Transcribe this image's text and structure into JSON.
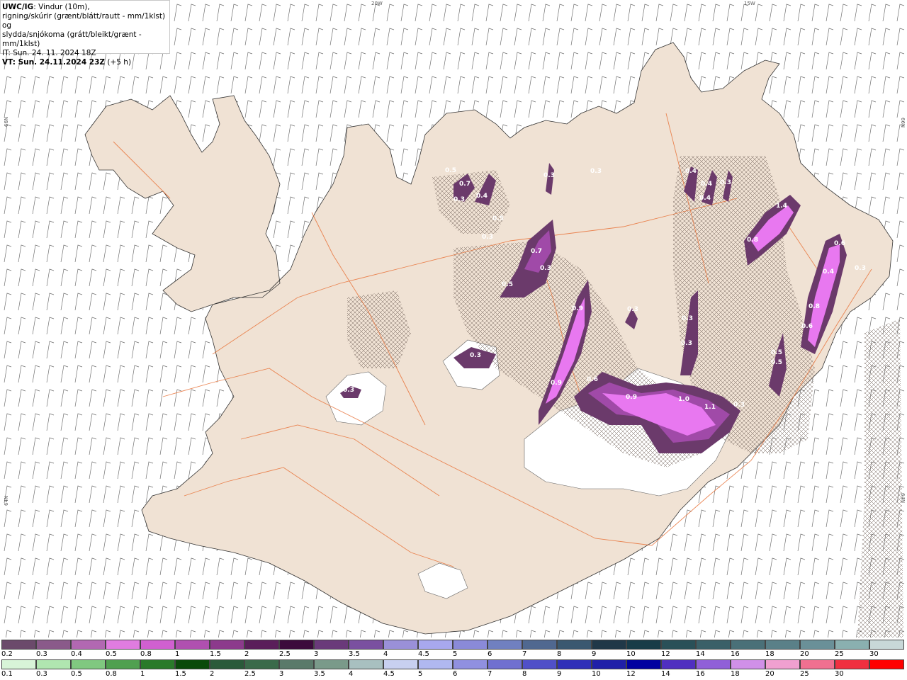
{
  "header": {
    "model": "UWC/IG",
    "line1_rest": ": Vindur (10m),",
    "line2": "rigning/skúrir (grænt/blátt/rautt - mm/1klst) og",
    "line3": "slydda/snjókoma (grátt/bleikt/grænt - mm/1klst)",
    "init_time": "IT: Sun. 24. 11. 2024 18Z",
    "valid_time": "VT: Sun. 24.11.2024 23Z",
    "lead": "(+5 h)"
  },
  "graticule": {
    "top_left": "20W",
    "top_right": "15W",
    "left_upper": "66N",
    "right_upper": "66N",
    "left_lower": "64N",
    "right_lower": "64N"
  },
  "precip_labels": [
    "0.3",
    "0.5",
    "0.7",
    "0.4",
    "0.3",
    "0.3",
    "0.5",
    "0.3",
    "0.7",
    "0.3",
    "0.5",
    "0.9",
    "0.9",
    "0.6",
    "0.9",
    "1.0",
    "1.1",
    "0.3",
    "0.3",
    "0.3",
    "0.3",
    "0.4",
    "0.4",
    "0.4",
    "0.3",
    "1.4",
    "0.8",
    "0.6",
    "0.4",
    "0.3",
    "0.8",
    "0.6",
    "0.5",
    "0.5",
    "0.3",
    "0.3"
  ],
  "legend_snow": {
    "labels": [
      "0.2",
      "0.3",
      "0.4",
      "0.5",
      "0.8",
      "1",
      "1.5",
      "2",
      "2.5",
      "3",
      "3.5",
      "4",
      "4.5",
      "5",
      "6",
      "7",
      "8",
      "9",
      "10",
      "12",
      "14",
      "16",
      "18",
      "20",
      "25",
      "30"
    ],
    "colors": [
      "#6b4a6b",
      "#8a5a8a",
      "#b268b2",
      "#e07ce0",
      "#d060d0",
      "#b050b0",
      "#8c3a8c",
      "#5a1e5a",
      "#3c0a3c",
      "#6a3a7a",
      "#7a50a0",
      "#9a90d8",
      "#a8a8ee",
      "#8a8ad8",
      "#7080c0",
      "#506890",
      "#3a5870",
      "#203848",
      "#183c48",
      "#2a5058",
      "#3a6068",
      "#4a7078",
      "#5a8088",
      "#6a9098",
      "#8ab0b0",
      "#c8d8d8"
    ]
  },
  "legend_rain": {
    "labels": [
      "0.1",
      "0.3",
      "0.5",
      "0.8",
      "1",
      "1.5",
      "2",
      "2.5",
      "3",
      "3.5",
      "4",
      "4.5",
      "5",
      "6",
      "7",
      "8",
      "9",
      "10",
      "12",
      "14",
      "16",
      "18",
      "20",
      "25",
      "30"
    ],
    "colors": [
      "#d8f4d8",
      "#b0e6b0",
      "#80c880",
      "#50a050",
      "#2a7a2a",
      "#0a4a0a",
      "#2a5a3a",
      "#3a6a4a",
      "#5a7a6a",
      "#7a9a8a",
      "#a8c0c0",
      "#c8d0f0",
      "#b0b8f0",
      "#9090e0",
      "#7070d0",
      "#5050c8",
      "#3030b8",
      "#2020a8",
      "#0000a0",
      "#5030c0",
      "#9060d8",
      "#d090e8",
      "#f0a0d0",
      "#f07090",
      "#f03040",
      "#ff0000"
    ]
  },
  "colors": {
    "land": "#f0e2d4",
    "road": "#e8733a",
    "snow_hatch": "#7a6a60",
    "precip_dark": "#6b3a6b",
    "precip_mid": "#a04aa8",
    "precip_light": "#e878f0"
  }
}
